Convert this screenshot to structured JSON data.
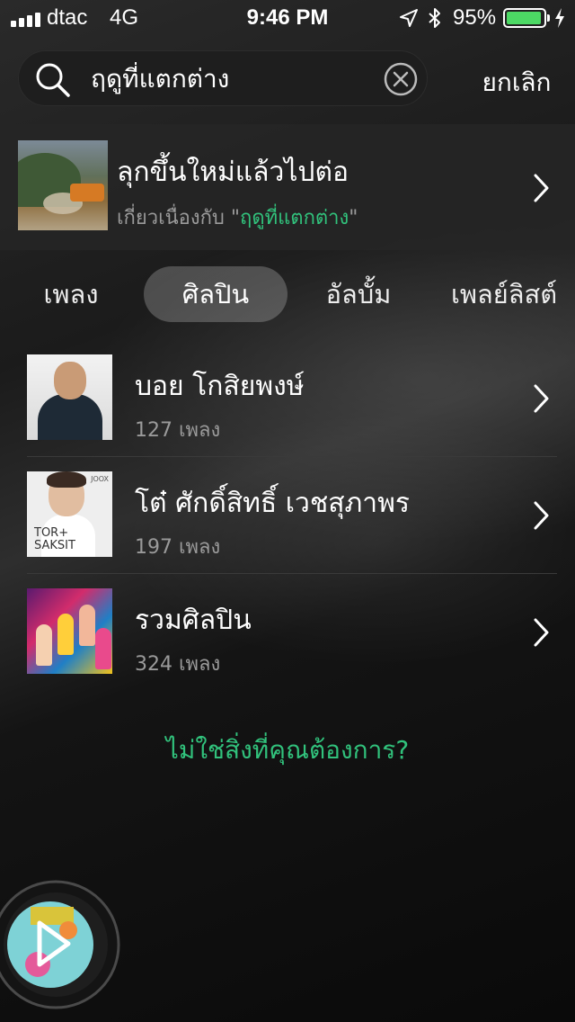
{
  "status": {
    "carrier": "dtac",
    "network": "4G",
    "time": "9:46 PM",
    "battery": "95%",
    "battery_level": 0.95,
    "battery_color": "#4cd964"
  },
  "search": {
    "query": "ฤดูที่แตกต่าง",
    "cancel_label": "ยกเลิก"
  },
  "suggestion": {
    "title": "ลุกขึ้นใหม่แล้วไปต่อ",
    "related_prefix": "เกี่ยวเนื่องกับ \"",
    "related_keyword": "ฤดูที่แตกต่าง",
    "related_suffix": "\""
  },
  "tabs": [
    {
      "label": "เพลง",
      "active": false
    },
    {
      "label": "ศิลปิน",
      "active": true
    },
    {
      "label": "อัลบั้ม",
      "active": false
    },
    {
      "label": "เพลย์ลิสต์",
      "active": false
    }
  ],
  "artists": [
    {
      "name": "บอย โกสิยพงษ์",
      "count": "127 เพลง"
    },
    {
      "name": "โต๋ ศักดิ์สิทธิ์ เวชสุภาพร",
      "count": "197 เพลง",
      "album_brand": "JOOX",
      "cover_text": "TOR+ SAKSIT"
    },
    {
      "name": "รวมศิลปิน",
      "count": "324 เพลง"
    }
  ],
  "not_found": "ไม่ใช่สิ่งที่คุณต้องการ?",
  "theme": {
    "accent": "#31c27c"
  },
  "icons": {
    "search": "search-icon",
    "clear": "clear-icon",
    "chevron": "chevron-right-icon",
    "play": "play-icon",
    "location": "location-arrow-icon",
    "bluetooth": "bluetooth-icon",
    "charging": "charging-bolt-icon"
  }
}
